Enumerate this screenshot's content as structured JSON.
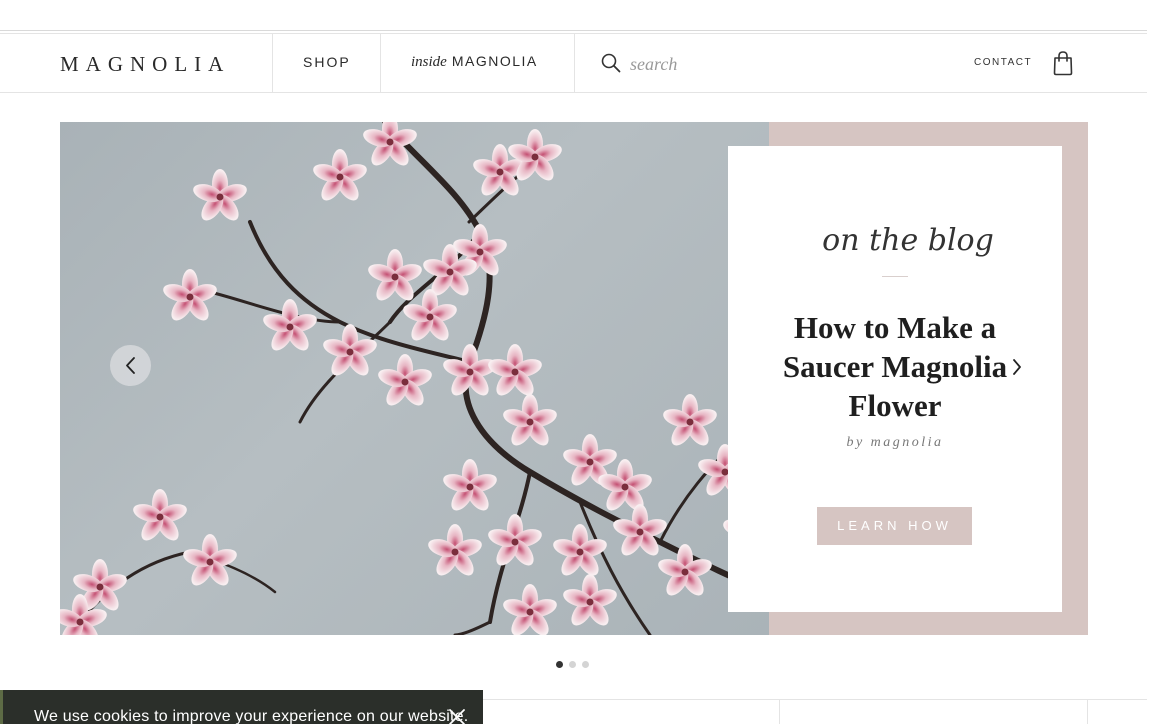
{
  "header": {
    "logo": "MAGNOLIA",
    "nav": {
      "shop": "SHOP",
      "inside_prefix": "inside",
      "inside_brand": "MAGNOLIA"
    },
    "search": {
      "placeholder": "search"
    },
    "contact": "CONTACT",
    "icons": {
      "search": "search-icon",
      "bag": "shopping-bag-icon"
    }
  },
  "hero": {
    "eyebrow_script": "on the blog",
    "title": "How to Make a Saucer Magnolia Flower",
    "byline": "by magnolia",
    "cta": "LEARN HOW",
    "accent_color": "#d6c5c2",
    "image": "saucer magnolia branch photo",
    "controls": {
      "prev": "chevron-left-icon",
      "next": "chevron-right-icon"
    },
    "slides": {
      "count": 3,
      "active": 1
    }
  },
  "cookie_banner": {
    "text": "We use cookies to improve your experience on our website.",
    "close_icon": "close-icon",
    "background": "#2b2f2a"
  }
}
